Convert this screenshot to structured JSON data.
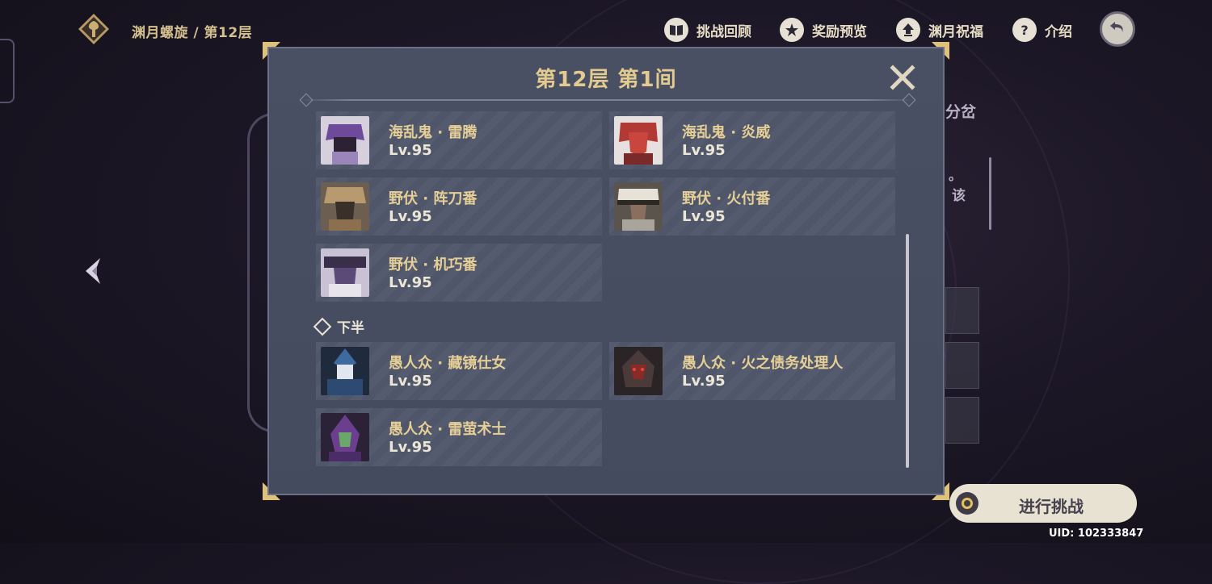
{
  "header": {
    "breadcrumb": "渊月螺旋 / 第12层",
    "nav": [
      {
        "label": "挑战回顾",
        "icon": "book-icon"
      },
      {
        "label": "奖励预览",
        "icon": "star-badge-icon"
      },
      {
        "label": "渊月祝福",
        "icon": "upload-icon"
      },
      {
        "label": "介绍",
        "icon": "help-icon"
      }
    ]
  },
  "background": {
    "side_text_1": "分岔",
    "side_text_2": "。",
    "side_text_3": "该"
  },
  "dialog": {
    "title": "第12层 第1间",
    "first_half": [
      {
        "name": "海乱鬼 · 雷腾",
        "level": "Lv.95",
        "color": "#6e4b9a"
      },
      {
        "name": "海乱鬼 · 炎威",
        "level": "Lv.95",
        "color": "#b23a34"
      },
      {
        "name": "野伏 · 阵刀番",
        "level": "Lv.95",
        "color": "#8b6f4f"
      },
      {
        "name": "野伏 · 火付番",
        "level": "Lv.95",
        "color": "#a9a59a"
      },
      {
        "name": "野伏 · 机巧番",
        "level": "Lv.95",
        "color": "#5b4a78"
      }
    ],
    "second_half_label": "下半",
    "second_half": [
      {
        "name": "愚人众 · 藏镜仕女",
        "level": "Lv.95",
        "color": "#3f6a9e"
      },
      {
        "name": "愚人众 · 火之债务处理人",
        "level": "Lv.95",
        "color": "#4a3a3a"
      },
      {
        "name": "愚人众 · 雷萤术士",
        "level": "Lv.95",
        "color": "#6b3f8e"
      }
    ]
  },
  "footer": {
    "start_label": "进行挑战",
    "uid": "UID: 102333847"
  }
}
